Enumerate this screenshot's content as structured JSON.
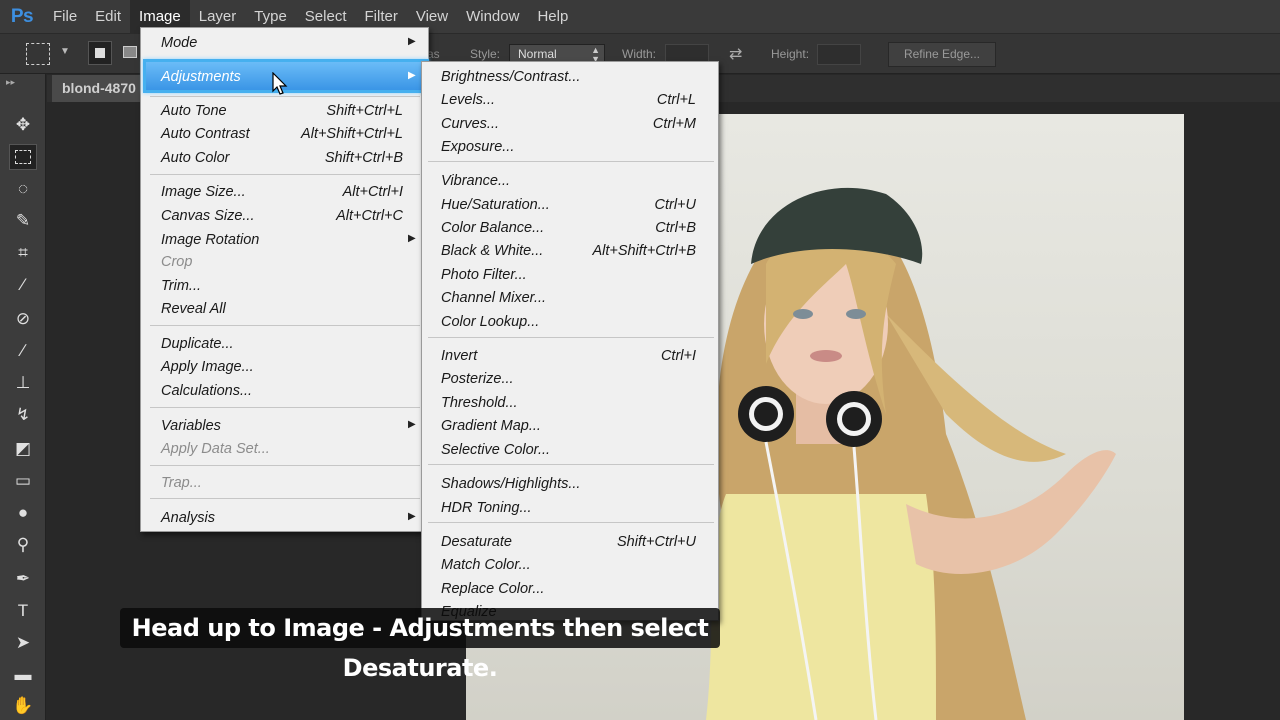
{
  "app": {
    "logo": "Ps",
    "menus": [
      "File",
      "Edit",
      "Image",
      "Layer",
      "Type",
      "Select",
      "Filter",
      "View",
      "Window",
      "Help"
    ],
    "active_menu": "Image"
  },
  "options_bar": {
    "partial_text": "as",
    "style_label": "Style:",
    "style_value": "Normal",
    "width_label": "Width:",
    "height_label": "Height:",
    "refine_edge": "Refine Edge..."
  },
  "document": {
    "tab_title": "blond-4870"
  },
  "image_menu": {
    "items": [
      {
        "label": "Mode",
        "submenu": true
      },
      {
        "label": "Adjustments",
        "submenu": true,
        "highlighted": true
      },
      {
        "label": "Auto Tone",
        "shortcut": "Shift+Ctrl+L"
      },
      {
        "label": "Auto Contrast",
        "shortcut": "Alt+Shift+Ctrl+L"
      },
      {
        "label": "Auto Color",
        "shortcut": "Shift+Ctrl+B"
      },
      {
        "label": "Image Size...",
        "shortcut": "Alt+Ctrl+I"
      },
      {
        "label": "Canvas Size...",
        "shortcut": "Alt+Ctrl+C"
      },
      {
        "label": "Image Rotation",
        "submenu": true
      },
      {
        "label": "Crop",
        "disabled": true
      },
      {
        "label": "Trim..."
      },
      {
        "label": "Reveal All"
      },
      {
        "label": "Duplicate..."
      },
      {
        "label": "Apply Image..."
      },
      {
        "label": "Calculations..."
      },
      {
        "label": "Variables",
        "submenu": true
      },
      {
        "label": "Apply Data Set...",
        "disabled": true
      },
      {
        "label": "Trap...",
        "disabled": true
      },
      {
        "label": "Analysis",
        "submenu": true
      }
    ]
  },
  "adjustments_menu": {
    "items": [
      {
        "label": "Brightness/Contrast..."
      },
      {
        "label": "Levels...",
        "shortcut": "Ctrl+L"
      },
      {
        "label": "Curves...",
        "shortcut": "Ctrl+M"
      },
      {
        "label": "Exposure..."
      },
      {
        "label": "Vibrance..."
      },
      {
        "label": "Hue/Saturation...",
        "shortcut": "Ctrl+U"
      },
      {
        "label": "Color Balance...",
        "shortcut": "Ctrl+B"
      },
      {
        "label": "Black & White...",
        "shortcut": "Alt+Shift+Ctrl+B"
      },
      {
        "label": "Photo Filter..."
      },
      {
        "label": "Channel Mixer..."
      },
      {
        "label": "Color Lookup..."
      },
      {
        "label": "Invert",
        "shortcut": "Ctrl+I"
      },
      {
        "label": "Posterize..."
      },
      {
        "label": "Threshold..."
      },
      {
        "label": "Gradient Map..."
      },
      {
        "label": "Selective Color..."
      },
      {
        "label": "Shadows/Highlights..."
      },
      {
        "label": "HDR Toning..."
      },
      {
        "label": "Desaturate",
        "shortcut": "Shift+Ctrl+U"
      },
      {
        "label": "Match Color..."
      },
      {
        "label": "Replace Color..."
      },
      {
        "label": "Equalize"
      }
    ]
  },
  "caption": "Head up to Image - Adjustments then select Desaturate.",
  "colors": {
    "accent_highlight": "#3a95e6",
    "ps_logo": "#3d8fe0",
    "menu_bg": "#f0f0f0"
  }
}
